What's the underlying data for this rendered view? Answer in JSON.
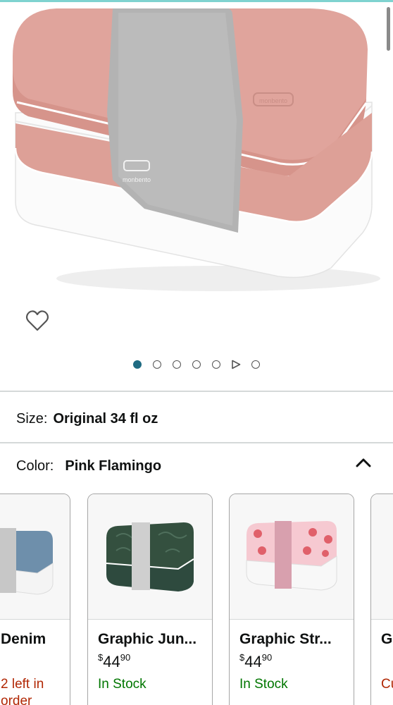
{
  "hero": {
    "brand": "monbento"
  },
  "wishlist": {
    "icon": "heart-outline-icon"
  },
  "gallery": {
    "total_items": 7,
    "active_index": 0,
    "video_index": 5
  },
  "size": {
    "label": "Size:",
    "value": "Original 34 fl oz"
  },
  "color": {
    "label": "Color:",
    "value": "Pink Flamingo",
    "expanded": true
  },
  "variants": [
    {
      "name": "Denim",
      "price_symbol": "",
      "price_whole": "",
      "price_fraction": "",
      "stock": "2 left in",
      "stock_sub": "order",
      "stock_low": true,
      "body": "#5e7f99",
      "lid": "#6e8fab",
      "band": "#c7c7c7",
      "base": "#f4f4f4"
    },
    {
      "name": "Graphic Jun...",
      "price_symbol": "$",
      "price_whole": "44",
      "price_fraction": "90",
      "stock": "In Stock",
      "stock_low": false,
      "body": "#2e4a3e",
      "lid": "#34503f",
      "band": "#cfcfcf",
      "base": "#2e4a3e"
    },
    {
      "name": "Graphic Str...",
      "price_symbol": "$",
      "price_whole": "44",
      "price_fraction": "90",
      "stock": "In Stock",
      "stock_low": false,
      "body": "#f3b9c4",
      "lid": "#f6c9d1",
      "band": "#d8a0ae",
      "base": "#f4f4f4"
    },
    {
      "name": "Gr",
      "price_symbol": "",
      "price_whole": "",
      "price_fraction": "",
      "stock": "Cu",
      "stock_low": true,
      "body": "#dddddd",
      "lid": "#e5e5e5",
      "band": "#cccccc",
      "base": "#f4f4f4"
    }
  ],
  "colors": {
    "accent": "#1f6b82",
    "in_stock": "#007600",
    "low_stock": "#b12704",
    "lid_pink": "#e0a49c",
    "base_white": "#ffffff"
  }
}
